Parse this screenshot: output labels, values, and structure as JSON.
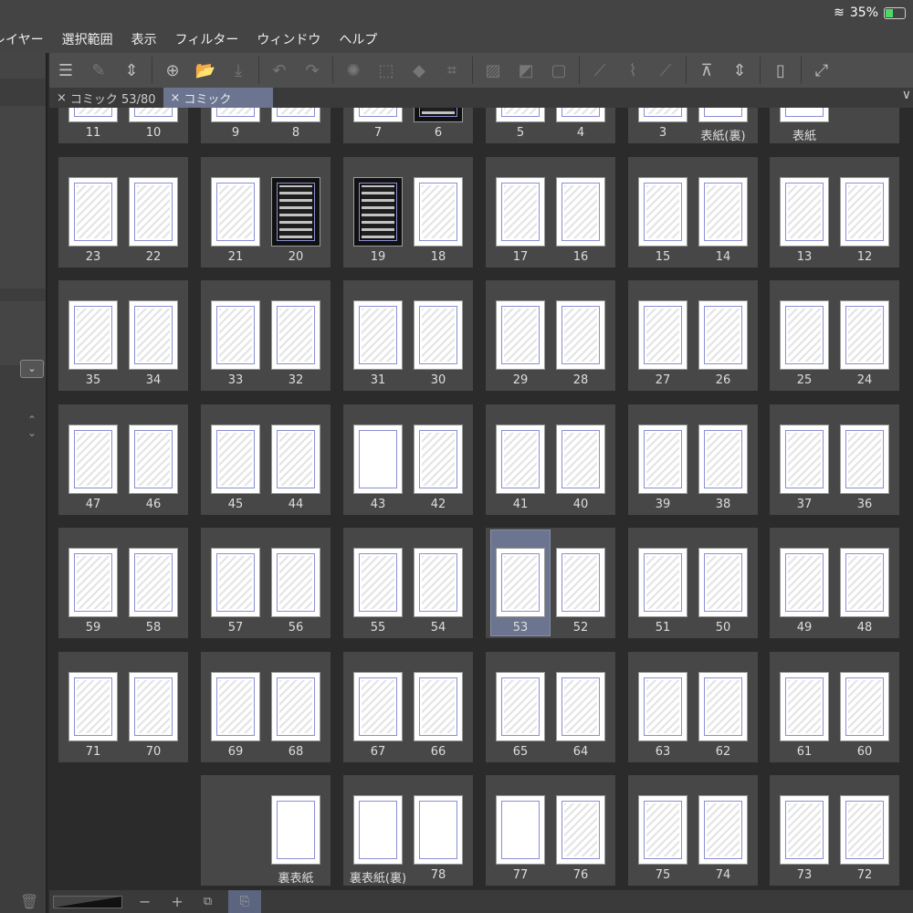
{
  "status": {
    "battery": "35%",
    "wifi_icon": "wifi-icon",
    "battery_icon": "battery-charging-icon"
  },
  "menu": [
    "レイヤー",
    "選択範囲",
    "表示",
    "フィルター",
    "ウィンドウ",
    "ヘルプ"
  ],
  "toolbar": [
    "menu-icon",
    "edit-page-icon",
    "up-down-icon",
    "add-page-icon",
    "open-folder-icon",
    "export-icon",
    "undo-icon",
    "redo-icon",
    "deselect-icon",
    "selection-icon",
    "fill-icon",
    "transform-icon",
    "clear-icon",
    "fill-selection-icon",
    "frame-icon",
    "pen-icon",
    "brush-icon",
    "eraser-icon",
    "page-manager-icon",
    "up-down-icon",
    "device-icon",
    "fullscreen-icon"
  ],
  "tabs": [
    {
      "label": "コミック 53/80",
      "active": false
    },
    {
      "label": "コミック",
      "active": true
    }
  ],
  "colors": {
    "selected": "#6b7590",
    "spread_bg": "#474747"
  },
  "rows": [
    [
      [
        "11",
        "10"
      ],
      [
        "9",
        "8"
      ],
      [
        "7",
        "6"
      ],
      [
        "5",
        "4"
      ],
      [
        "3",
        "表紙(裏)"
      ],
      [
        "表紙",
        ""
      ]
    ],
    [
      [
        "23",
        "22"
      ],
      [
        "21",
        "20"
      ],
      [
        "19",
        "18"
      ],
      [
        "17",
        "16"
      ],
      [
        "15",
        "14"
      ],
      [
        "13",
        "12"
      ]
    ],
    [
      [
        "35",
        "34"
      ],
      [
        "33",
        "32"
      ],
      [
        "31",
        "30"
      ],
      [
        "29",
        "28"
      ],
      [
        "27",
        "26"
      ],
      [
        "25",
        "24"
      ]
    ],
    [
      [
        "47",
        "46"
      ],
      [
        "45",
        "44"
      ],
      [
        "43",
        "42"
      ],
      [
        "41",
        "40"
      ],
      [
        "39",
        "38"
      ],
      [
        "37",
        "36"
      ]
    ],
    [
      [
        "59",
        "58"
      ],
      [
        "57",
        "56"
      ],
      [
        "55",
        "54"
      ],
      [
        "53",
        "52"
      ],
      [
        "51",
        "50"
      ],
      [
        "49",
        "48"
      ]
    ],
    [
      [
        "71",
        "70"
      ],
      [
        "69",
        "68"
      ],
      [
        "67",
        "66"
      ],
      [
        "65",
        "64"
      ],
      [
        "63",
        "62"
      ],
      [
        "61",
        "60"
      ]
    ],
    [
      null,
      [
        "",
        "裏表紙"
      ],
      [
        "裏表紙(裏)",
        "78"
      ],
      [
        "77",
        "76"
      ],
      [
        "75",
        "74"
      ],
      [
        "73",
        "72"
      ]
    ]
  ],
  "dark_pages": [
    "20",
    "19",
    "6"
  ],
  "blank_pages": [
    "表紙(裏)",
    "表紙",
    "裏表紙",
    "裏表紙(裏)",
    "78",
    "77",
    "43"
  ],
  "selected_page": "53",
  "bottom": {
    "minus": "−",
    "plus": "+"
  }
}
